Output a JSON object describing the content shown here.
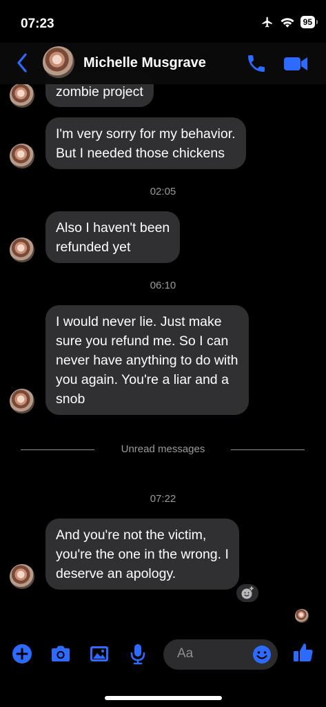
{
  "status": {
    "time": "07:23",
    "battery": "95"
  },
  "header": {
    "contact_name": "Michelle Musgrave"
  },
  "messages": [
    {
      "text": "zombie project"
    },
    {
      "text": "I'm very sorry for my behavior.\nBut I needed those chickens"
    },
    {
      "text": "Also I haven't been\nrefunded yet"
    },
    {
      "text": "I would never lie. Just make\nsure you refund me. So I can\nnever have anything to do with\nyou again. You're a liar and a\nsnob"
    },
    {
      "text": "And you're not the victim,\nyou're the one in the wrong. I\ndeserve an apology."
    }
  ],
  "timestamps": [
    "02:05",
    "06:10",
    "07:22"
  ],
  "divider": {
    "label": "Unread messages"
  },
  "composer": {
    "placeholder": "Aa"
  },
  "colors": {
    "accent": "#2d6bff",
    "bubble": "#303033",
    "background": "#000000"
  }
}
